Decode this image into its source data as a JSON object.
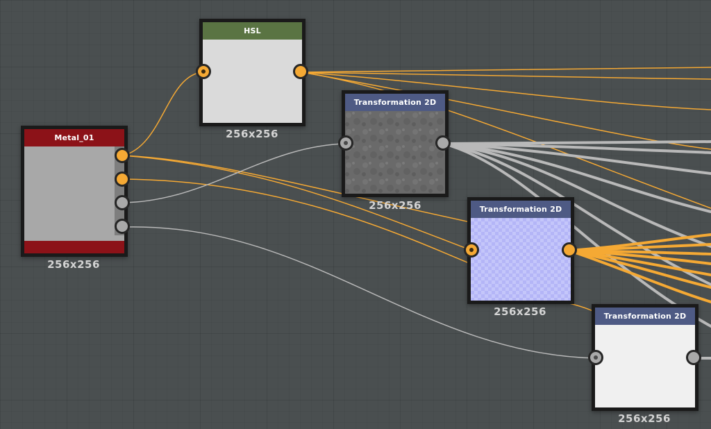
{
  "canvas": {
    "background": "#4a4f50",
    "grid": true
  },
  "colors": {
    "wire_orange": "#f5a934",
    "wire_gray": "#b9b9b9"
  },
  "nodes": {
    "metal": {
      "title": "Metal_01",
      "size_label": "256x256",
      "header_color": "#8c1218",
      "footer_color": "#8c1218",
      "thumbnail_color": "#a8a8a8",
      "outputs": [
        "orange",
        "orange",
        "gray",
        "gray"
      ]
    },
    "hsl": {
      "title": "HSL",
      "size_label": "256x256",
      "header_color": "#5a7443",
      "thumbnail_color": "#dadada",
      "input": "orange",
      "output": "orange"
    },
    "transform1": {
      "title": "Transformation 2D",
      "size_label": "256x256",
      "header_color": "#4e5a84",
      "thumbnail_color": "#6a6a6a",
      "input": "gray",
      "output": "gray"
    },
    "transform2": {
      "title": "Transformation 2D",
      "size_label": "256x256",
      "header_color": "#4e5a84",
      "thumbnail_color": "#c4c6fa",
      "input": "orange",
      "output": "orange"
    },
    "transform3": {
      "title": "Transformation 2D",
      "size_label": "256x256",
      "header_color": "#4e5a84",
      "thumbnail_color": "#f0f0f0",
      "input": "gray",
      "output": "gray"
    }
  }
}
